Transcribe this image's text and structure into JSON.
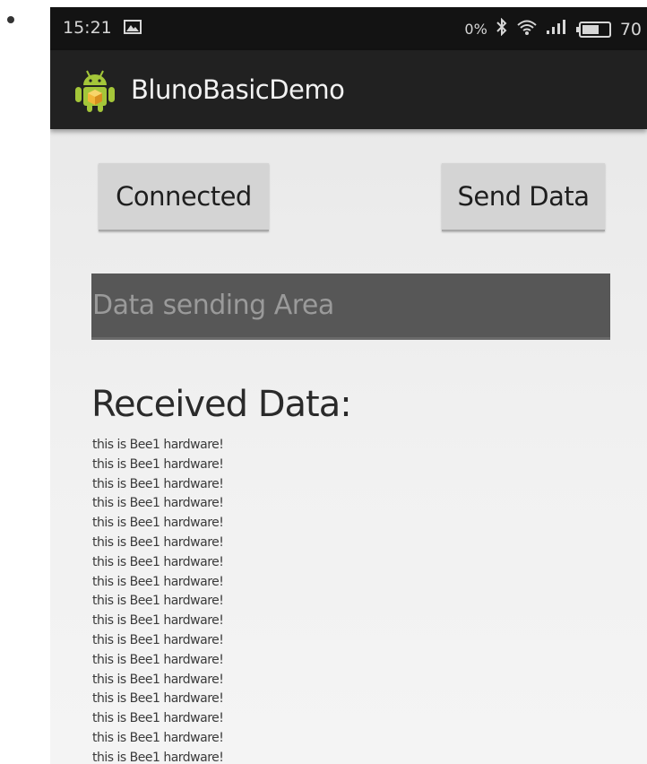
{
  "status_bar": {
    "time": "15:21",
    "gallery_icon": "image-icon",
    "speed": "0%",
    "bluetooth_icon": "bluetooth-icon",
    "wifi_icon": "wifi-icon",
    "signal_icon": "cell-signal-icon",
    "battery_level": "70",
    "battery_fraction": 0.7
  },
  "action_bar": {
    "app_icon": "android-app-icon",
    "title": "BlunoBasicDemo"
  },
  "controls": {
    "connect_label": "Connected",
    "send_label": "Send Data",
    "input_placeholder": "Data sending Area",
    "input_value": ""
  },
  "received": {
    "title": "Received Data:",
    "lines": [
      "this is Bee1 hardware!",
      "this is Bee1 hardware!",
      "this is Bee1 hardware!",
      "this is Bee1 hardware!",
      "this is Bee1 hardware!",
      "this is Bee1 hardware!",
      "this is Bee1 hardware!",
      "this is Bee1 hardware!",
      "this is Bee1 hardware!",
      "this is Bee1 hardware!",
      "this is Bee1 hardware!",
      "this is Bee1 hardware!",
      "this is Bee1 hardware!",
      "this is Bee1 hardware!",
      "this is Bee1 hardware!",
      "this is Bee1 hardware!",
      "this is Bee1 hardware!"
    ]
  },
  "colors": {
    "status_bar_bg": "#131313",
    "action_bar_bg": "#212121",
    "button_bg": "#d4d4d4",
    "input_bg": "#575757",
    "android_green": "#a4c639"
  }
}
